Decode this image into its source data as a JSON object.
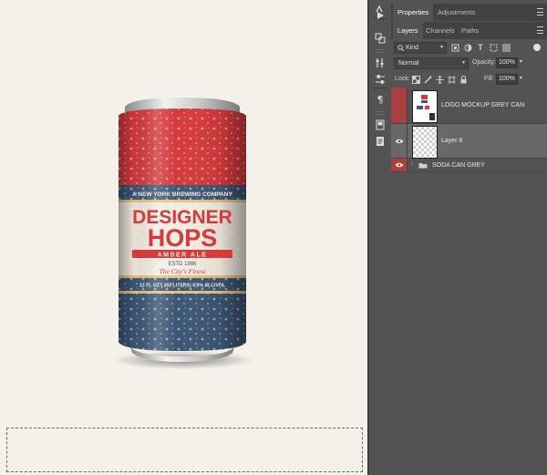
{
  "canvas": {
    "label": {
      "top_banner": "A NEW YORK BREWING COMPANY",
      "title_line1": "DESIGNER",
      "title_line2": "HOPS",
      "subtitle": "AMBER ALE",
      "established": "ESTD 1986",
      "tagline": "The City's Finest",
      "volume_band": "12 FL OZ (.355 LITERS) 6.0% ALC/VOL"
    }
  },
  "tools": {
    "items": [
      "move-tool",
      "play-icon",
      "clone-source-icon",
      "brush-settings-icon",
      "adjust-icon",
      "paragraph-icon",
      "swatch-icon",
      "notes-icon"
    ]
  },
  "properties_panel": {
    "tabs": [
      "Properties",
      "Adjustments"
    ]
  },
  "layers_panel": {
    "tabs": [
      "Layers",
      "Channels",
      "Paths"
    ],
    "filter_kind": "Kind",
    "blend_mode": "Normal",
    "opacity_label": "Opacity:",
    "opacity_value": "100%",
    "lock_label": "Lock:",
    "fill_label": "Fill:",
    "fill_value": "100%",
    "layers": [
      {
        "name": "LOGO MOCKUP GREY CAN",
        "visible": false,
        "selected": false
      },
      {
        "name": "Layer 8",
        "visible": true,
        "selected": true
      },
      {
        "name": "SODA CAN GREY",
        "visible": true,
        "selected": false,
        "type": "group"
      }
    ]
  },
  "colors": {
    "can_red": "#d63a3c",
    "can_blue": "#3c5775",
    "label_cream": "#f4ece0",
    "accent_gold": "#e9c27a",
    "eye_highlight": "#c43b3b"
  }
}
